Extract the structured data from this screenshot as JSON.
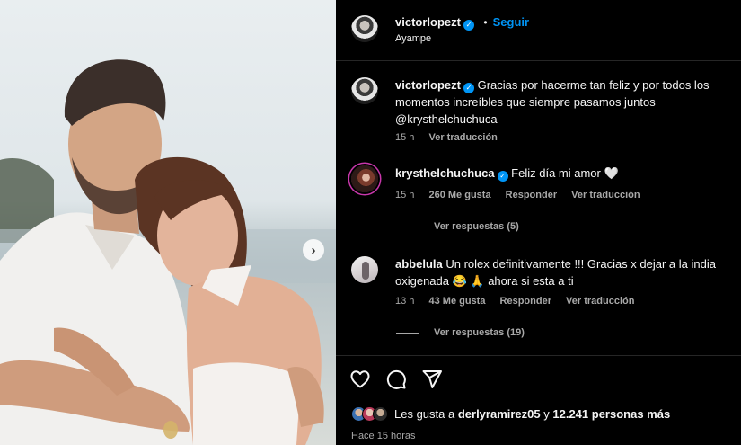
{
  "header": {
    "username": "victorlopezt",
    "separator": "•",
    "follow_label": "Seguir",
    "location": "Ayampe"
  },
  "caption": {
    "username": "victorlopezt",
    "text": "Gracias por hacerme tan feliz y por todos los momentos increíbles que siempre pasamos juntos",
    "mention": "@krysthelchuchuca",
    "time": "15 h",
    "translate_label": "Ver traducción"
  },
  "comments": [
    {
      "username": "krysthelchuchuca",
      "text": "Feliz día mi amor 🤍",
      "time": "15 h",
      "likes": "260 Me gusta",
      "reply_label": "Responder",
      "translate_label": "Ver traducción",
      "view_replies": "Ver respuestas (5)"
    },
    {
      "username": "abbelula",
      "text": "Un rolex definitivamente !!! Gracias x dejar a la india oxigenada 😂 🙏 ahora si esta a ti",
      "time": "13 h",
      "likes": "43 Me gusta",
      "reply_label": "Responder",
      "translate_label": "Ver traducción",
      "view_replies": "Ver respuestas (19)"
    }
  ],
  "footer": {
    "likes_prefix": "Les gusta a",
    "likes_user": "derlyramirez05",
    "likes_conjunction": "y",
    "likes_count": "12.241 personas más",
    "posted_time": "Hace 15 horas"
  },
  "icons": {
    "like": "heart-icon",
    "comment": "comment-icon",
    "share": "share-icon",
    "verified": "verified-badge-icon",
    "next": "chevron-right-icon"
  },
  "colors": {
    "background": "#000000",
    "text": "#f5f5f5",
    "secondary_text": "#a8a8a8",
    "accent": "#0095f6",
    "verified": "#0095f6"
  }
}
